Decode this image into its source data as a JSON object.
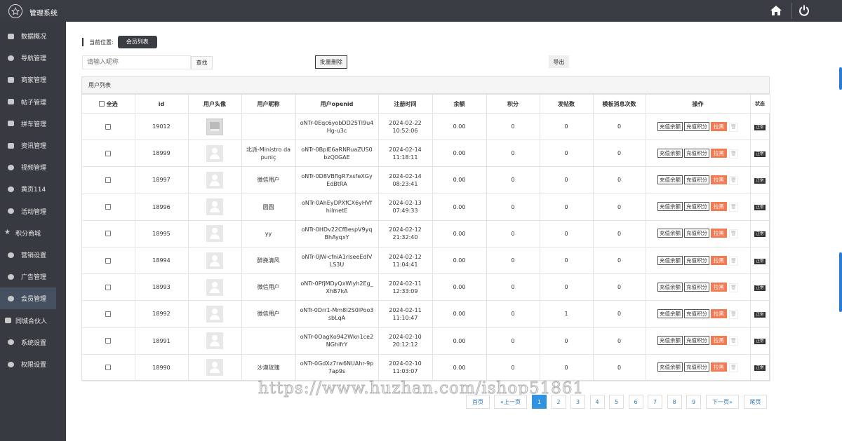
{
  "header": {
    "title": "管理系统",
    "logo_icon": "star-icon",
    "home_icon": "home-icon",
    "power_icon": "power-icon"
  },
  "sidebar": {
    "items": [
      {
        "label": "数据概况",
        "icon": "dashboard-icon"
      },
      {
        "label": "导航管理",
        "icon": "navigation-icon"
      },
      {
        "label": "商家管理",
        "icon": "bank-icon"
      },
      {
        "label": "帖子管理",
        "icon": "comment-icon"
      },
      {
        "label": "拼车管理",
        "icon": "car-icon"
      },
      {
        "label": "资讯管理",
        "icon": "news-icon"
      },
      {
        "label": "视频管理",
        "icon": "video-icon"
      },
      {
        "label": "黄页114",
        "icon": "yellow-pages-icon"
      },
      {
        "label": "活动管理",
        "icon": "activity-icon"
      },
      {
        "label": "积分商城",
        "icon": "star-icon"
      },
      {
        "label": "营销设置",
        "icon": "marketing-icon"
      },
      {
        "label": "广告管理",
        "icon": "ad-icon"
      },
      {
        "label": "会员管理",
        "icon": "user-icon",
        "active": true
      },
      {
        "label": "同城合伙人",
        "icon": "partner-icon"
      },
      {
        "label": "系统设置",
        "icon": "settings-icon"
      },
      {
        "label": "权限设置",
        "icon": "permission-icon"
      }
    ]
  },
  "breadcrumb": {
    "label": "当前位置:",
    "current": "会员列表"
  },
  "search": {
    "placeholder": "请输入昵称",
    "button": "查找"
  },
  "toolbar": {
    "bulk_delete": "批量删除",
    "export": "导出"
  },
  "panel": {
    "title": "用户列表"
  },
  "table": {
    "headers": {
      "select_all": "全选",
      "id": "id",
      "avatar": "用户头像",
      "nickname": "用户昵称",
      "openid": "用户openid",
      "reg_time": "注册时间",
      "balance": "余额",
      "points": "积分",
      "posts": "发帖数",
      "template_msgs": "模板消息次数",
      "actions": "操作",
      "status": "状态"
    },
    "actions": {
      "recharge_balance": "充值余额",
      "recharge_points": "充值积分",
      "block": "拉黑"
    },
    "rows": [
      {
        "id": "19012",
        "avatar": "image",
        "nickname": "",
        "openid": "oNTr-0Eqc6yobDD25Tl9u4Hg-u3c",
        "date": "2024-02-22",
        "time": "10:52:06",
        "balance": "0.00",
        "points": "0",
        "posts": "0",
        "msgs": "0",
        "status": "正常"
      },
      {
        "id": "18999",
        "avatar": "default",
        "nickname": "北派-Ministro da puniç",
        "openid": "oNTr-0BpIE6aRNRuaZUS0bzQ0GAE",
        "date": "2024-02-14",
        "time": "11:18:11",
        "balance": "0.00",
        "points": "0",
        "posts": "0",
        "msgs": "0",
        "status": "正常"
      },
      {
        "id": "18997",
        "avatar": "default",
        "nickname": "微信用户",
        "openid": "oNTr-0D8VBflgR7xsfeXGyEdBtRA",
        "date": "2024-02-14",
        "time": "08:23:41",
        "balance": "0.00",
        "points": "0",
        "posts": "0",
        "msgs": "0",
        "status": "正常"
      },
      {
        "id": "18996",
        "avatar": "default",
        "nickname": "圆圆",
        "openid": "oNTr-0AhEyDPXfCX6yHVfhilmetE",
        "date": "2024-02-13",
        "time": "07:49:33",
        "balance": "0.00",
        "points": "0",
        "posts": "0",
        "msgs": "0",
        "status": "正常"
      },
      {
        "id": "18995",
        "avatar": "default",
        "nickname": "yy",
        "openid": "oNTr-0HDv22CfBespV9yqBhAyqxY",
        "date": "2024-02-12",
        "time": "21:32:40",
        "balance": "0.00",
        "points": "0",
        "posts": "0",
        "msgs": "0",
        "status": "正常"
      },
      {
        "id": "18994",
        "avatar": "default",
        "nickname": "醉挽清风",
        "openid": "oNTr-0JW-cfniA1rlseeEdIVLS3U",
        "date": "2024-02-12",
        "time": "11:04:41",
        "balance": "0.00",
        "points": "0",
        "posts": "0",
        "msgs": "0",
        "status": "正常"
      },
      {
        "id": "18993",
        "avatar": "default",
        "nickname": "微信用户",
        "openid": "oNTr-0PfjMDyQxWlyh2Eg_XhB7kA",
        "date": "2024-02-11",
        "time": "12:33:09",
        "balance": "0.00",
        "points": "0",
        "posts": "0",
        "msgs": "0",
        "status": "正常"
      },
      {
        "id": "18992",
        "avatar": "default",
        "nickname": "微信用户",
        "openid": "oNTr-0Drr1-Mm8I2S0lPoo3sbLqA",
        "date": "2024-02-11",
        "time": "11:10:47",
        "balance": "0.00",
        "points": "0",
        "posts": "1",
        "msgs": "0",
        "status": "正常"
      },
      {
        "id": "18991",
        "avatar": "default",
        "nickname": "",
        "openid": "oNTr-0OagXo942Wkn1ce2NGhifrY",
        "date": "2024-02-10",
        "time": "20:12:12",
        "balance": "0.00",
        "points": "0",
        "posts": "0",
        "msgs": "0",
        "status": "正常"
      },
      {
        "id": "18990",
        "avatar": "default",
        "nickname": "沙漠玫瑰",
        "openid": "oNTr-0GdXz7rw6NUAhr-9p7ap9s",
        "date": "2024-02-10",
        "time": "11:03:07",
        "balance": "0.00",
        "points": "0",
        "posts": "0",
        "msgs": "0",
        "status": "正常"
      }
    ]
  },
  "pagination": {
    "first": "首页",
    "prev": "«上一页",
    "pages": [
      "1",
      "2",
      "3",
      "4",
      "5",
      "6",
      "7",
      "8",
      "9"
    ],
    "current": "1",
    "next": "下一页»",
    "last": "尾页"
  },
  "watermark": "https://www.huzhan.com/ishop51861",
  "colors": {
    "topbar": "#393c42",
    "sidebar": "#373a40",
    "active_item": "#444f60",
    "block_button": "#f37b53",
    "page_active": "#2f93e2"
  }
}
